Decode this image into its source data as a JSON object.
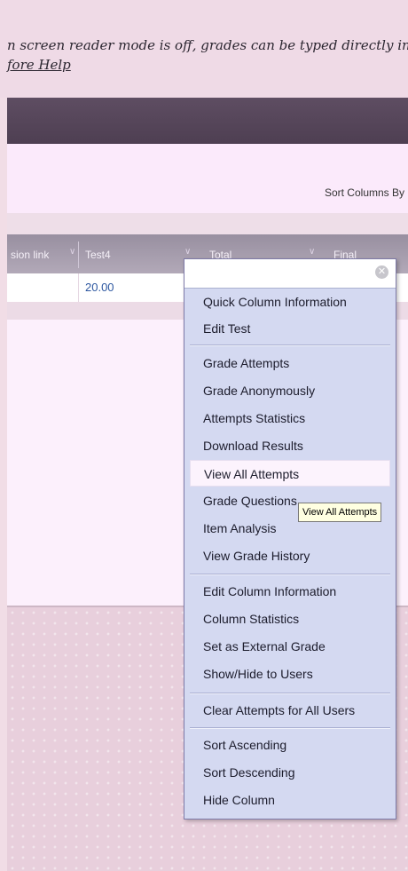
{
  "notice": {
    "line1": "n screen reader mode is off, grades can be typed directly in",
    "line2_link": "fore Help"
  },
  "sort_label": "Sort Columns By",
  "grid": {
    "columns": [
      {
        "label": "sion link"
      },
      {
        "label": "Test4"
      },
      {
        "label": "Total"
      },
      {
        "label": "Final"
      }
    ],
    "row": {
      "test4_value": "20.00"
    }
  },
  "menu": {
    "close_icon": "close-x-icon",
    "groups": [
      [
        "Quick Column Information",
        "Edit Test"
      ],
      [
        "Grade Attempts",
        "Grade Anonymously",
        "Attempts Statistics",
        "Download Results",
        "View All Attempts",
        "Grade Questions",
        "Item Analysis",
        "View Grade History"
      ],
      [
        "Edit Column Information",
        "Column Statistics",
        "Set as External Grade",
        "Show/Hide to Users"
      ],
      [
        "Clear Attempts for All Users"
      ],
      [
        "Sort Ascending",
        "Sort Descending",
        "Hide Column"
      ]
    ],
    "highlighted_item": "View All Attempts"
  },
  "tooltip": "View All Attempts",
  "colors": {
    "menu_bg": "#d4d9f1",
    "header_bar": "#5e4d62",
    "link_blue": "#2d57a0"
  }
}
